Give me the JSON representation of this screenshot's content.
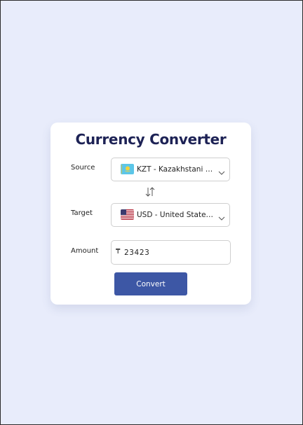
{
  "converter": {
    "title": "Currency Converter",
    "source": {
      "label": "Source",
      "selected": "KZT - Kazakhstani Tenge",
      "flag_icon": "kazakhstan-flag-icon"
    },
    "swap_icon": "swap-arrows-icon",
    "target": {
      "label": "Target",
      "selected": "USD - United States Dollar",
      "flag_icon": "united-states-flag-icon"
    },
    "amount": {
      "label": "Amount",
      "currency_symbol": "₸",
      "value": "23423"
    },
    "convert_label": "Convert"
  },
  "colors": {
    "page_background": "#e8ecfb",
    "card_background": "#ffffff",
    "title": "#1d2255",
    "button": "#3d57a5"
  }
}
